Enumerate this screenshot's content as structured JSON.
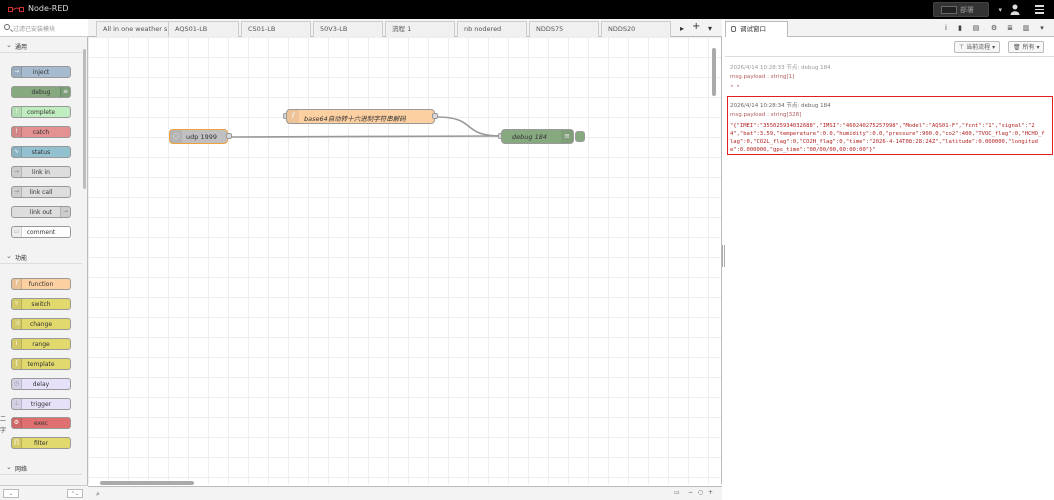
{
  "header": {
    "app_name": "Node-RED",
    "deploy_label": "部署"
  },
  "palette": {
    "search_placeholder": "过滤已安装模块",
    "categories": [
      {
        "label": "通用"
      },
      {
        "label": "功能"
      },
      {
        "label": "网络"
      }
    ],
    "nodes_common": [
      {
        "label": "inject",
        "color": "#a6bbcf",
        "icon": "arrow-right-icon"
      },
      {
        "label": "debug",
        "color": "#87a980",
        "icon": "list-icon"
      },
      {
        "label": "complete",
        "color": "#c0edc0",
        "icon": "exclamation-icon"
      },
      {
        "label": "catch",
        "color": "#e49191",
        "icon": "exclamation-icon"
      },
      {
        "label": "status",
        "color": "#94c1d0",
        "icon": "pulse-icon"
      },
      {
        "label": "link in",
        "color": "#dddddd",
        "icon": "link-icon"
      },
      {
        "label": "link call",
        "color": "#dddddd",
        "icon": "link-icon"
      },
      {
        "label": "link out",
        "color": "#dddddd",
        "icon": "link-icon"
      },
      {
        "label": "comment",
        "color": "#ffffff",
        "icon": "comment-icon"
      }
    ],
    "nodes_function": [
      {
        "label": "function",
        "color": "#fdd0a2",
        "icon": "f-icon"
      },
      {
        "label": "switch",
        "color": "#e2d96e",
        "icon": "switch-icon"
      },
      {
        "label": "change",
        "color": "#e2d96e",
        "icon": "shuffle-icon"
      },
      {
        "label": "range",
        "color": "#e2d96e",
        "icon": "range-icon"
      },
      {
        "label": "template",
        "color": "#e2d96e",
        "icon": "brace-icon"
      },
      {
        "label": "delay",
        "color": "#e6e0f8",
        "icon": "clock-icon"
      },
      {
        "label": "trigger",
        "color": "#e6e0f8",
        "icon": "trigger-icon"
      },
      {
        "label": "exec",
        "color": "#e07070",
        "icon": "gear-icon"
      },
      {
        "label": "filter",
        "color": "#e2d96e",
        "icon": "filter-icon"
      }
    ],
    "edge_text": [
      "二",
      "字"
    ]
  },
  "tabs": [
    {
      "label": "All in one weather s"
    },
    {
      "label": "AQS01-LB"
    },
    {
      "label": "CS01-LB"
    },
    {
      "label": "50V3-LB"
    },
    {
      "label": "流程 1"
    },
    {
      "label": "nb nodered"
    },
    {
      "label": "NDDS75"
    },
    {
      "label": "NDDS20"
    }
  ],
  "flow": {
    "nodes": [
      {
        "label": "udp 1999",
        "color": "#c0c0c0"
      },
      {
        "label": "base64自动转十六进制字符串解码",
        "color": "#fdd0a2"
      },
      {
        "label": "debug 184",
        "color": "#87a980"
      }
    ]
  },
  "sidebar": {
    "tab_label": "调试窗口",
    "filter_label": "当前流程",
    "clear_label": "所有",
    "messages": [
      {
        "meta": "2026/4/14 10:28:33   节点: debug 184",
        "meta2": "msg.payload : string[1]",
        "payload": "\" \""
      },
      {
        "meta": "2026/4/14 10:28:34   节点: debug 184",
        "meta2": "msg.payload : string[328]",
        "payload": "\"{\"IMEI\":\"355025934032688\",\"IMSI\":\"460240275257998\",\"Model\":\"AQS01-F\",\"fcnt\":\"1\",\"signal\":\"24\",\"bat\":3.59,\"temperature\":0.0,\"humidity\":0.0,\"pressure\":900.0,\"co2\":400,\"TVOC_flag\":0,\"HCHO_flag\":0,\"CO2L_flag\":0,\"CO2H_flag\":0,\"time\":\"2026-4-14T08:28:24Z\",\"latitude\":0.000000,\"longitude\":0.000000,\"gps_time\":\"00/00/00,00:00:00\"}\""
      }
    ]
  }
}
